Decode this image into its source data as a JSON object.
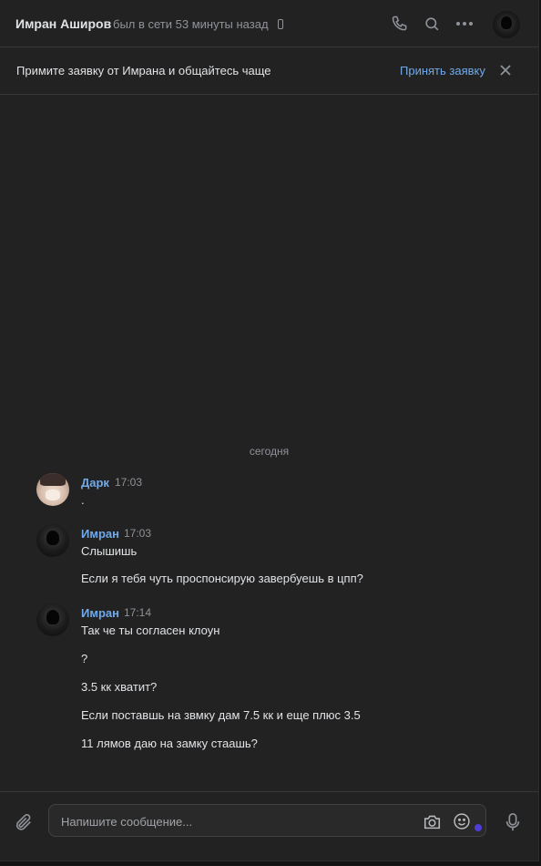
{
  "header": {
    "name": "Имран Аширов",
    "status": "был в сети 53 минуты назад"
  },
  "banner": {
    "text": "Примите заявку от Имрана и общайтесь чаще",
    "accept": "Принять заявку"
  },
  "day_separator": "сегодня",
  "messages": [
    {
      "author": "Дарк",
      "time": "17:03",
      "lines": [
        "."
      ]
    },
    {
      "author": "Имран",
      "time": "17:03",
      "lines": [
        "Слышишь",
        "Если я тебя чуть проспонсирую завербуешь в цпп?"
      ]
    },
    {
      "author": "Имран",
      "time": "17:14",
      "lines": [
        "Так че ты согласен клоун",
        "?",
        "3.5 кк хватит?",
        "Если поставшь на звмку дам 7.5 кк и еще плюс 3.5",
        "11 лямов даю на замку стаашь?"
      ]
    }
  ],
  "composer": {
    "placeholder": "Напишите сообщение..."
  },
  "colors": {
    "accent": "#71aaeb",
    "background": "#222222",
    "unread_dot": "#4f3ed6"
  }
}
